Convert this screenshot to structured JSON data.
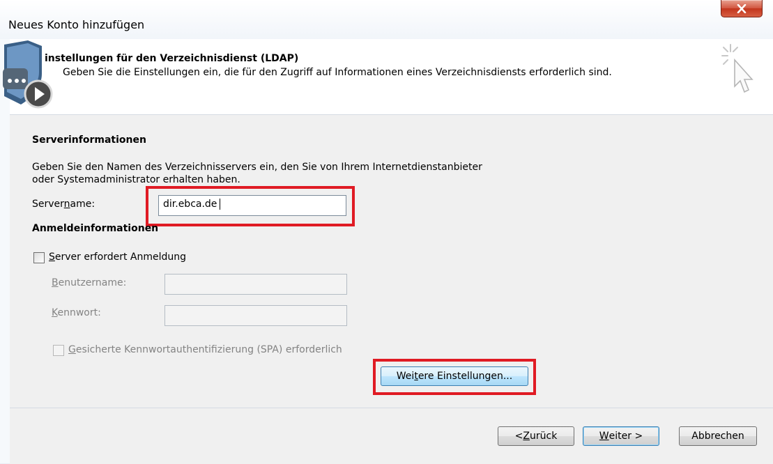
{
  "window": {
    "title": "Neues Konto hinzufügen",
    "close_label": "X"
  },
  "header": {
    "title": "instellungen für den Verzeichnisdienst (LDAP)",
    "subtitle": "Geben Sie die Einstellungen ein, die für den Zugriff auf Informationen eines Verzeichnisdiensts erforderlich sind."
  },
  "server_info": {
    "title": "Serverinformationen",
    "description_line1": "Geben Sie den Namen des Verzeichnisservers ein, den Sie von Ihrem Internetdienstanbieter",
    "description_line2": "oder Systemadministrator erhalten haben.",
    "servername_label_pre": "Server",
    "servername_label_key": "n",
    "servername_label_post": "ame:",
    "servername_value": "dir.ebca.de"
  },
  "login_info": {
    "title": "Anmeldeinformationen",
    "require_login_key": "S",
    "require_login_rest": "erver erfordert Anmeldung",
    "username_key": "B",
    "username_rest": "enutzername:",
    "username_value": "",
    "password_key": "K",
    "password_rest": "ennwort:",
    "password_value": "",
    "spa_key": "G",
    "spa_rest": "esicherte Kennwortauthentifizierung (SPA) erforderlich"
  },
  "more_settings": {
    "pre": "Wei",
    "key": "t",
    "post": "ere Einstellungen..."
  },
  "footer": {
    "back_pre": "< ",
    "back_key": "Z",
    "back_post": "urück",
    "next_key": "W",
    "next_post": "eiter >",
    "cancel_label": "Abbrechen"
  },
  "colors": {
    "highlight": "#e01b24",
    "close_button": "#c2351d",
    "default_button_border": "#3c7fb1"
  },
  "icons": [
    "close-icon",
    "ldap-shield-icon",
    "play-icon",
    "cursor-sparkle-icon"
  ]
}
